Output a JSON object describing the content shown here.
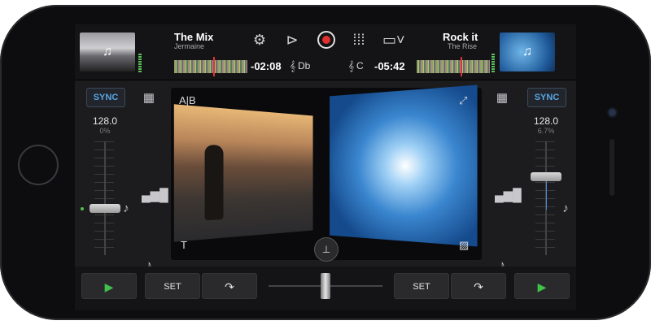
{
  "top_bar": {
    "left_track": {
      "title": "The Mix",
      "artist": "Jermaine",
      "time": "-02:08",
      "key": "Db"
    },
    "right_track": {
      "title": "Rock it",
      "artist": "The Rise",
      "time": "-05:42",
      "key": "C"
    },
    "icons": {
      "settings": "gear-icon",
      "video_fx": "video-mixer-icon",
      "record": "record-icon",
      "grid": "grid-icon",
      "display": "external-display-icon"
    }
  },
  "left_deck": {
    "sync_label": "SYNC",
    "bpm": "128.0",
    "pitch": "0%"
  },
  "right_deck": {
    "sync_label": "SYNC",
    "bpm": "128.0",
    "pitch": "6.7%"
  },
  "video": {
    "ab_badge": "A|B",
    "text_icon": "T"
  },
  "transport": {
    "left_play": "▶",
    "left_set": "SET",
    "right_set": "SET",
    "right_play": "▶"
  },
  "colors": {
    "accent_blue": "#58a7e8",
    "play_green": "#3fc14a",
    "record_red": "#e03030"
  }
}
